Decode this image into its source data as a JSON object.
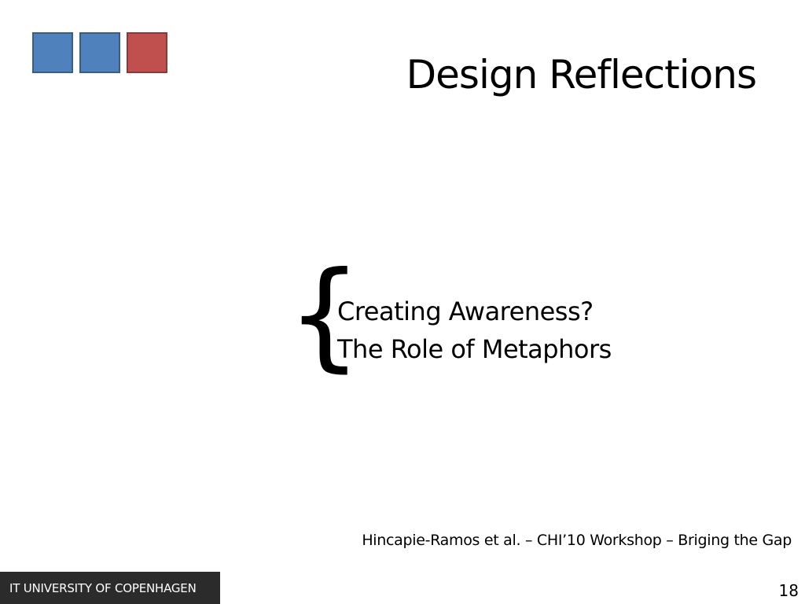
{
  "slide": {
    "title": "Design Reflections",
    "brace_glyph": "{",
    "lines": [
      "Creating Awareness?",
      "The Role of Metaphors"
    ],
    "citation": "Hincapie-Ramos et al. – CHI’10 Workshop – Briging the Gap",
    "footer_label": "IT UNIVERSITY OF COPENHAGEN",
    "page_number": "18"
  },
  "logo": {
    "squares": [
      {
        "fill": "#4f81bd",
        "border": "#385d8a"
      },
      {
        "fill": "#4f81bd",
        "border": "#385d8a"
      },
      {
        "fill": "#c0504d",
        "border": "#8c3836"
      }
    ]
  },
  "colors": {
    "footer_bar": "#2b2b2b",
    "text": "#000000"
  }
}
